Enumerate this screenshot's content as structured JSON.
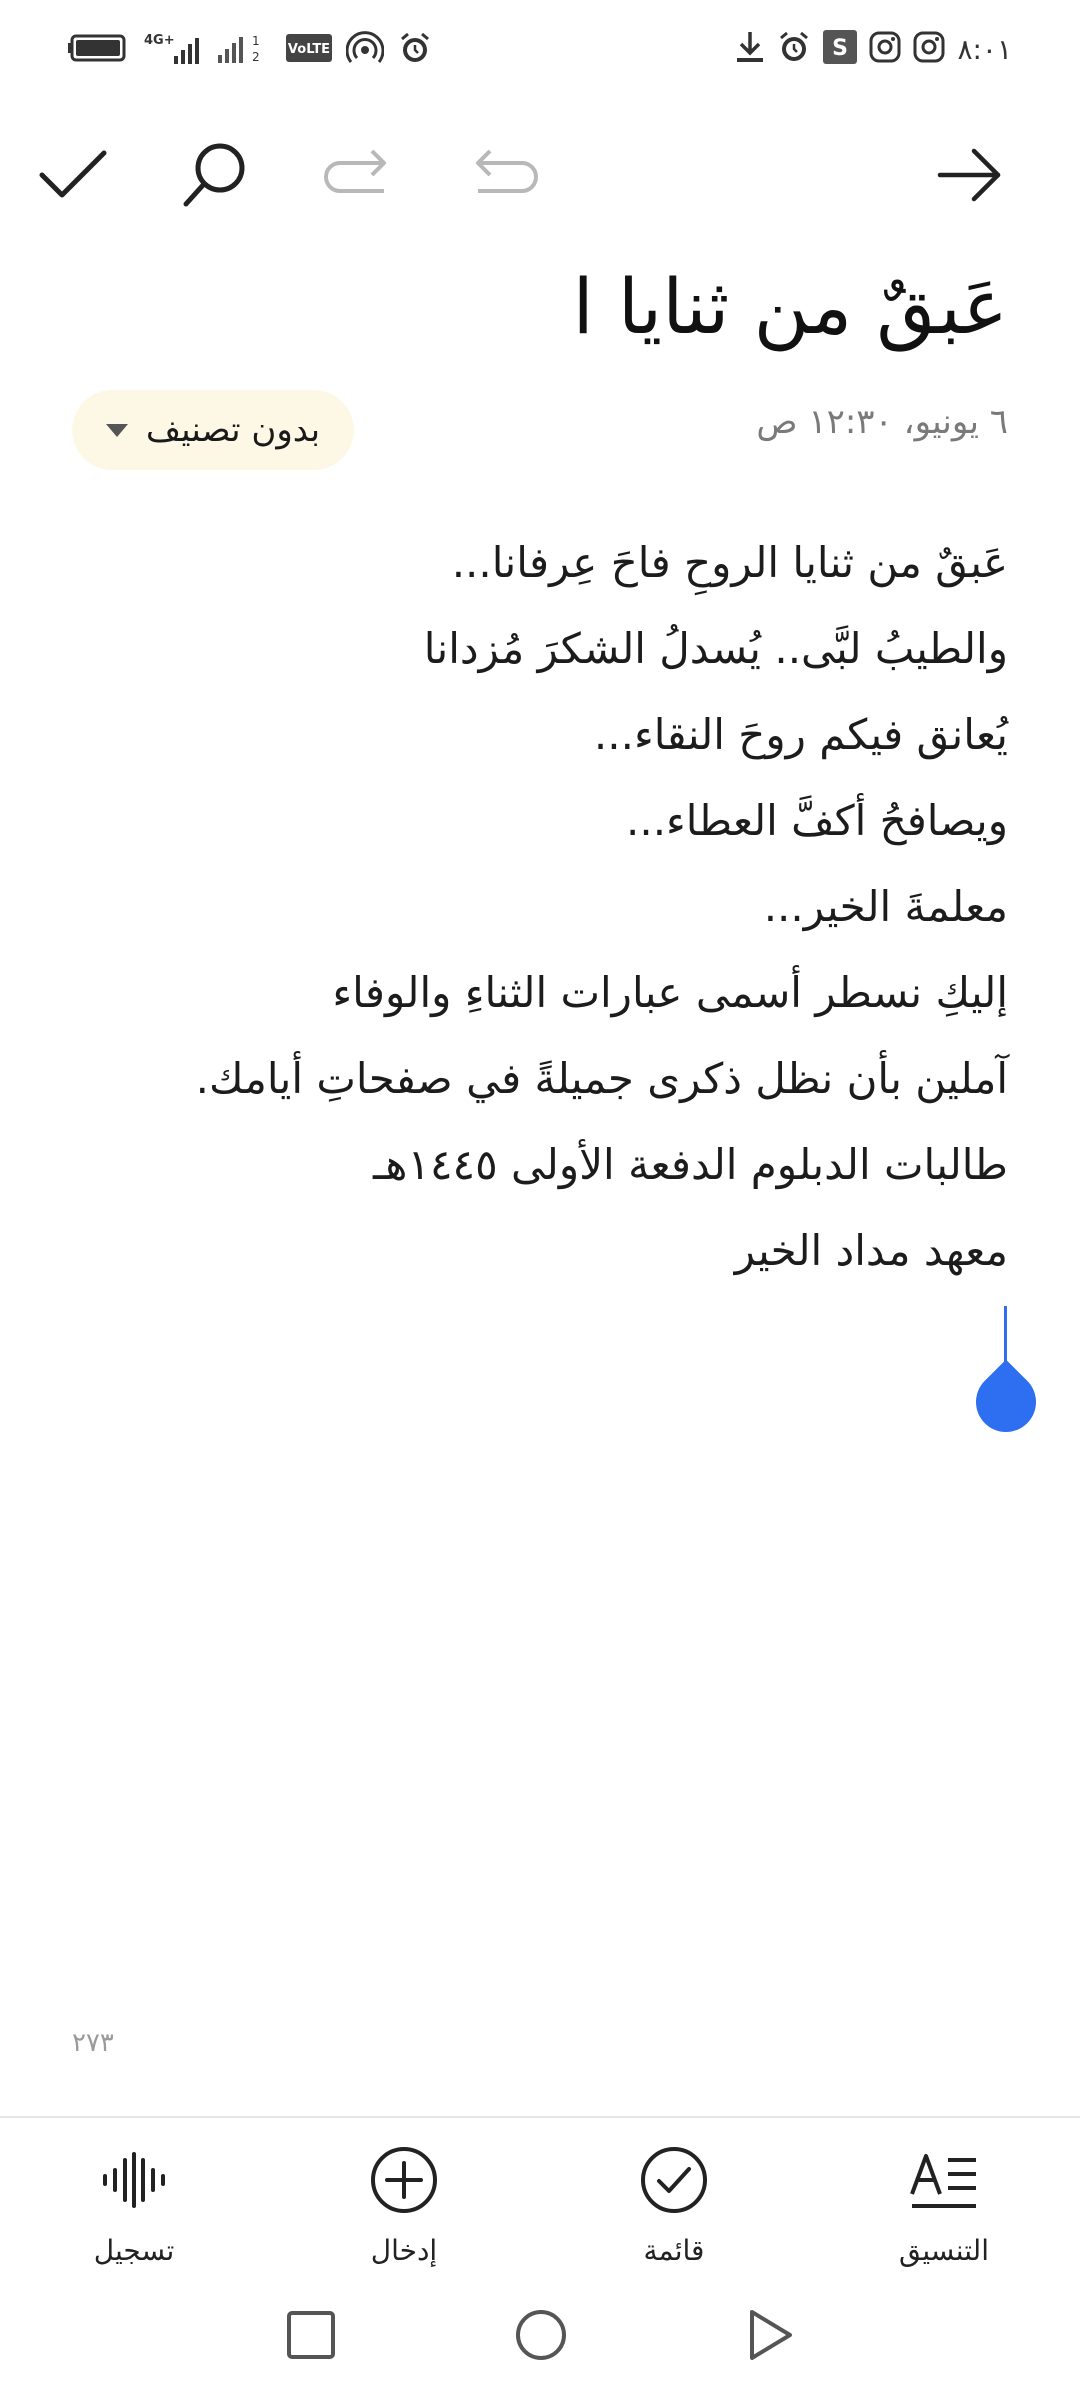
{
  "status_bar": {
    "time": "٨:٠١",
    "left_icons": [
      "battery-icon",
      "signal-4g-icon",
      "signal-icon",
      "volte-icon",
      "hotspot-icon",
      "alarm-icon"
    ],
    "right_icons": [
      "download-icon",
      "alarm-icon",
      "s-app-icon",
      "instagram-icon",
      "instagram-icon"
    ],
    "volte_label": "VoLTE",
    "network_label": "4G+"
  },
  "toolbar": {
    "icons": [
      "check-icon",
      "search-icon",
      "redo-icon",
      "undo-icon",
      "back-arrow-icon"
    ]
  },
  "note": {
    "title": "عَبقٌ من ثنايا ا",
    "date": "٦ يونيو، ١٢:٣٠ ص",
    "category": "بدون تصنيف",
    "lines": [
      "عَبقٌ من ثنايا الروحِ فاحَ عِرفانا...",
      "والطيبُ لبَّى.. يُسدلُ الشكرَ مُزدانا",
      "يُعانق فيكم روحَ النقاء...",
      "ويصافحُ أكفَّ العطاء...",
      "معلمةَ الخير...",
      "إليكِ نسطر أسمى عبارات الثناءِ والوفاء",
      "آملين بأن نظل ذكرى جميلةً في صفحاتِ أيامك.",
      "طالبات الدبلوم الدفعة الأولى ١٤٤٥هـ",
      "معهد مداد الخير"
    ],
    "char_count": "٢٧٣"
  },
  "bottom_bar": {
    "record": "تسجيل",
    "insert": "إدخال",
    "checklist": "قائمة",
    "format": "التنسيق"
  },
  "colors": {
    "accent": "#2d6ff0",
    "chip_bg": "#fdf8e6",
    "muted_text": "#7a7a7a"
  }
}
